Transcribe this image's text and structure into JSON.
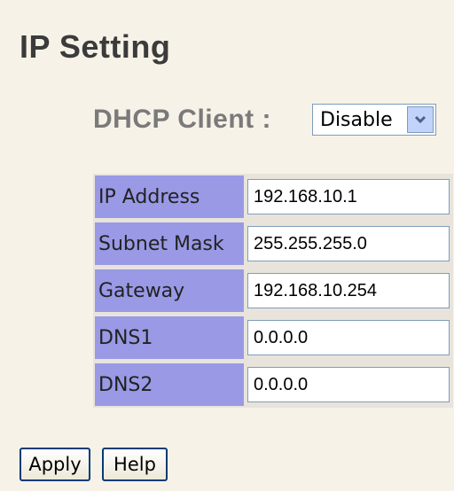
{
  "page": {
    "title": "IP Setting"
  },
  "dhcp": {
    "label": "DHCP Client :",
    "selected": "Disable"
  },
  "settings": {
    "rows": [
      {
        "label": "IP Address",
        "value": "192.168.10.1"
      },
      {
        "label": "Subnet Mask",
        "value": "255.255.255.0"
      },
      {
        "label": "Gateway",
        "value": "192.168.10.254"
      },
      {
        "label": "DNS1",
        "value": "0.0.0.0"
      },
      {
        "label": "DNS2",
        "value": "0.0.0.0"
      }
    ]
  },
  "buttons": {
    "apply": "Apply",
    "help": "Help"
  },
  "icons": {
    "dropdown": "chevron-down-icon"
  },
  "colors": {
    "background": "#f7f2e8",
    "label_cell": "#9999e6",
    "title_text": "#3b3b3b",
    "dhcp_text": "#7a7a7a"
  }
}
